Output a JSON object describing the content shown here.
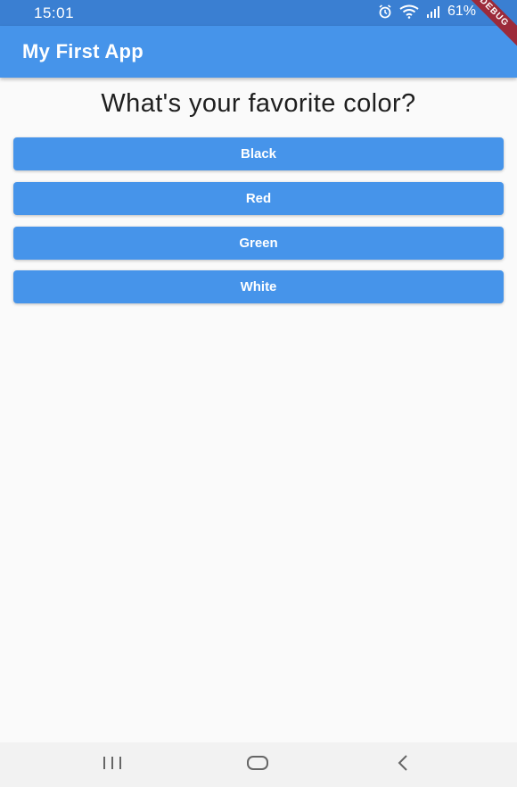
{
  "status_bar": {
    "time": "15:01",
    "battery": "61%",
    "icons": [
      "alarm-icon",
      "wifi-icon",
      "signal-icon",
      "battery-icon"
    ]
  },
  "debug_banner": "DEBUG",
  "app_bar": {
    "title": "My First App"
  },
  "quiz": {
    "question": "What's your favorite color?",
    "answers": [
      {
        "label": "Black"
      },
      {
        "label": "Red"
      },
      {
        "label": "Green"
      },
      {
        "label": "White"
      }
    ]
  },
  "nav_bar": {
    "icons": [
      "recent-apps-icon",
      "home-icon",
      "back-icon"
    ]
  },
  "colors": {
    "status_bar": "#3a7fd2",
    "app_bar": "#4694ea",
    "button": "#4694ea",
    "background": "#fafafa",
    "debug_banner": "#9c2a3a"
  }
}
